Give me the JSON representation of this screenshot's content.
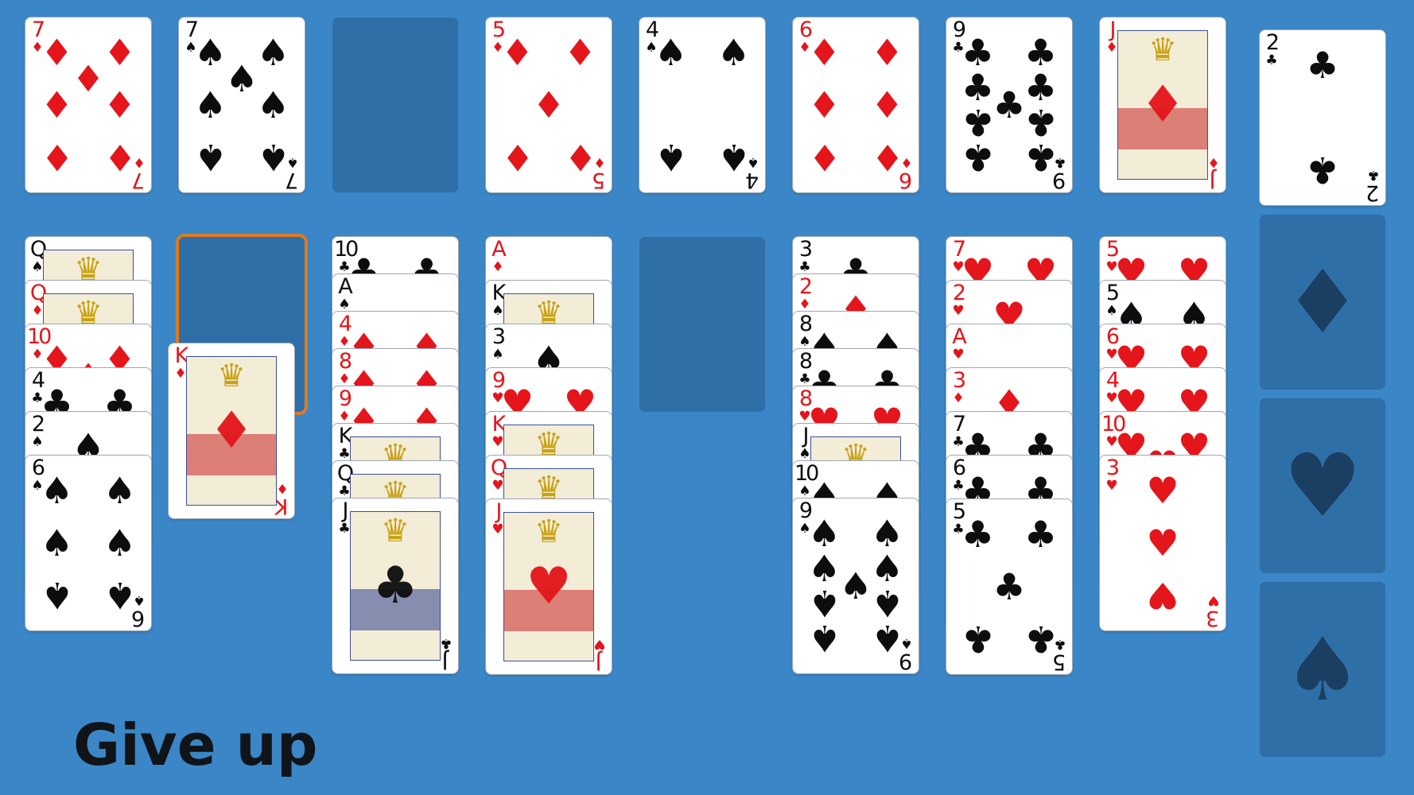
{
  "colors": {
    "table": "#3b86c6",
    "slot": "#2f6fa8",
    "selection": "#e07a1e",
    "red": "#e4151b",
    "black": "#0d0d0d"
  },
  "top_row": [
    {
      "rank": "7",
      "suit": "♦",
      "color": "red"
    },
    {
      "rank": "7",
      "suit": "♠",
      "color": "black"
    },
    null,
    {
      "rank": "5",
      "suit": "♦",
      "color": "red"
    },
    {
      "rank": "4",
      "suit": "♠",
      "color": "black"
    },
    {
      "rank": "6",
      "suit": "♦",
      "color": "red"
    },
    {
      "rank": "9",
      "suit": "♣",
      "color": "black"
    },
    {
      "rank": "J",
      "suit": "♦",
      "color": "red"
    }
  ],
  "tableau": [
    [
      {
        "rank": "Q",
        "suit": "♠",
        "color": "black"
      },
      {
        "rank": "Q",
        "suit": "♦",
        "color": "red"
      },
      {
        "rank": "10",
        "suit": "♦",
        "color": "red"
      },
      {
        "rank": "4",
        "suit": "♣",
        "color": "black"
      },
      {
        "rank": "2",
        "suit": "♠",
        "color": "black"
      },
      {
        "rank": "6",
        "suit": "♠",
        "color": "black"
      }
    ],
    [],
    [
      {
        "rank": "10",
        "suit": "♣",
        "color": "black"
      },
      {
        "rank": "A",
        "suit": "♠",
        "color": "black"
      },
      {
        "rank": "4",
        "suit": "♦",
        "color": "red"
      },
      {
        "rank": "8",
        "suit": "♦",
        "color": "red"
      },
      {
        "rank": "9",
        "suit": "♦",
        "color": "red"
      },
      {
        "rank": "K",
        "suit": "♣",
        "color": "black"
      },
      {
        "rank": "Q",
        "suit": "♣",
        "color": "black"
      },
      {
        "rank": "J",
        "suit": "♣",
        "color": "black"
      }
    ],
    [
      {
        "rank": "A",
        "suit": "♦",
        "color": "red"
      },
      {
        "rank": "K",
        "suit": "♠",
        "color": "black"
      },
      {
        "rank": "3",
        "suit": "♠",
        "color": "black"
      },
      {
        "rank": "9",
        "suit": "♥",
        "color": "red"
      },
      {
        "rank": "K",
        "suit": "♥",
        "color": "red"
      },
      {
        "rank": "Q",
        "suit": "♥",
        "color": "red"
      },
      {
        "rank": "J",
        "suit": "♥",
        "color": "red"
      }
    ],
    [],
    [
      {
        "rank": "3",
        "suit": "♣",
        "color": "black"
      },
      {
        "rank": "2",
        "suit": "♦",
        "color": "red"
      },
      {
        "rank": "8",
        "suit": "♠",
        "color": "black"
      },
      {
        "rank": "8",
        "suit": "♣",
        "color": "black"
      },
      {
        "rank": "8",
        "suit": "♥",
        "color": "red"
      },
      {
        "rank": "J",
        "suit": "♠",
        "color": "black"
      },
      {
        "rank": "10",
        "suit": "♠",
        "color": "black"
      },
      {
        "rank": "9",
        "suit": "♠",
        "color": "black"
      }
    ],
    [
      {
        "rank": "7",
        "suit": "♥",
        "color": "red"
      },
      {
        "rank": "2",
        "suit": "♥",
        "color": "red"
      },
      {
        "rank": "A",
        "suit": "♥",
        "color": "red"
      },
      {
        "rank": "3",
        "suit": "♦",
        "color": "red"
      },
      {
        "rank": "7",
        "suit": "♣",
        "color": "black"
      },
      {
        "rank": "6",
        "suit": "♣",
        "color": "black"
      },
      {
        "rank": "5",
        "suit": "♣",
        "color": "black"
      }
    ],
    [
      {
        "rank": "5",
        "suit": "♥",
        "color": "red"
      },
      {
        "rank": "5",
        "suit": "♠",
        "color": "black"
      },
      {
        "rank": "6",
        "suit": "♥",
        "color": "red"
      },
      {
        "rank": "4",
        "suit": "♥",
        "color": "red"
      },
      {
        "rank": "10",
        "suit": "♥",
        "color": "red"
      },
      {
        "rank": "3",
        "suit": "♥",
        "color": "red"
      }
    ]
  ],
  "dragged_card": {
    "rank": "K",
    "suit": "♦",
    "color": "red"
  },
  "foundations": [
    {
      "card": {
        "rank": "2",
        "suit": "♣",
        "color": "black"
      },
      "icon": "club-icon"
    },
    {
      "card": null,
      "placeholder": "♦",
      "icon": "diamond-icon"
    },
    {
      "card": null,
      "placeholder": "♥",
      "icon": "heart-icon"
    },
    {
      "card": null,
      "placeholder": "♠",
      "icon": "spade-icon"
    }
  ],
  "give_up_label": "Give up"
}
